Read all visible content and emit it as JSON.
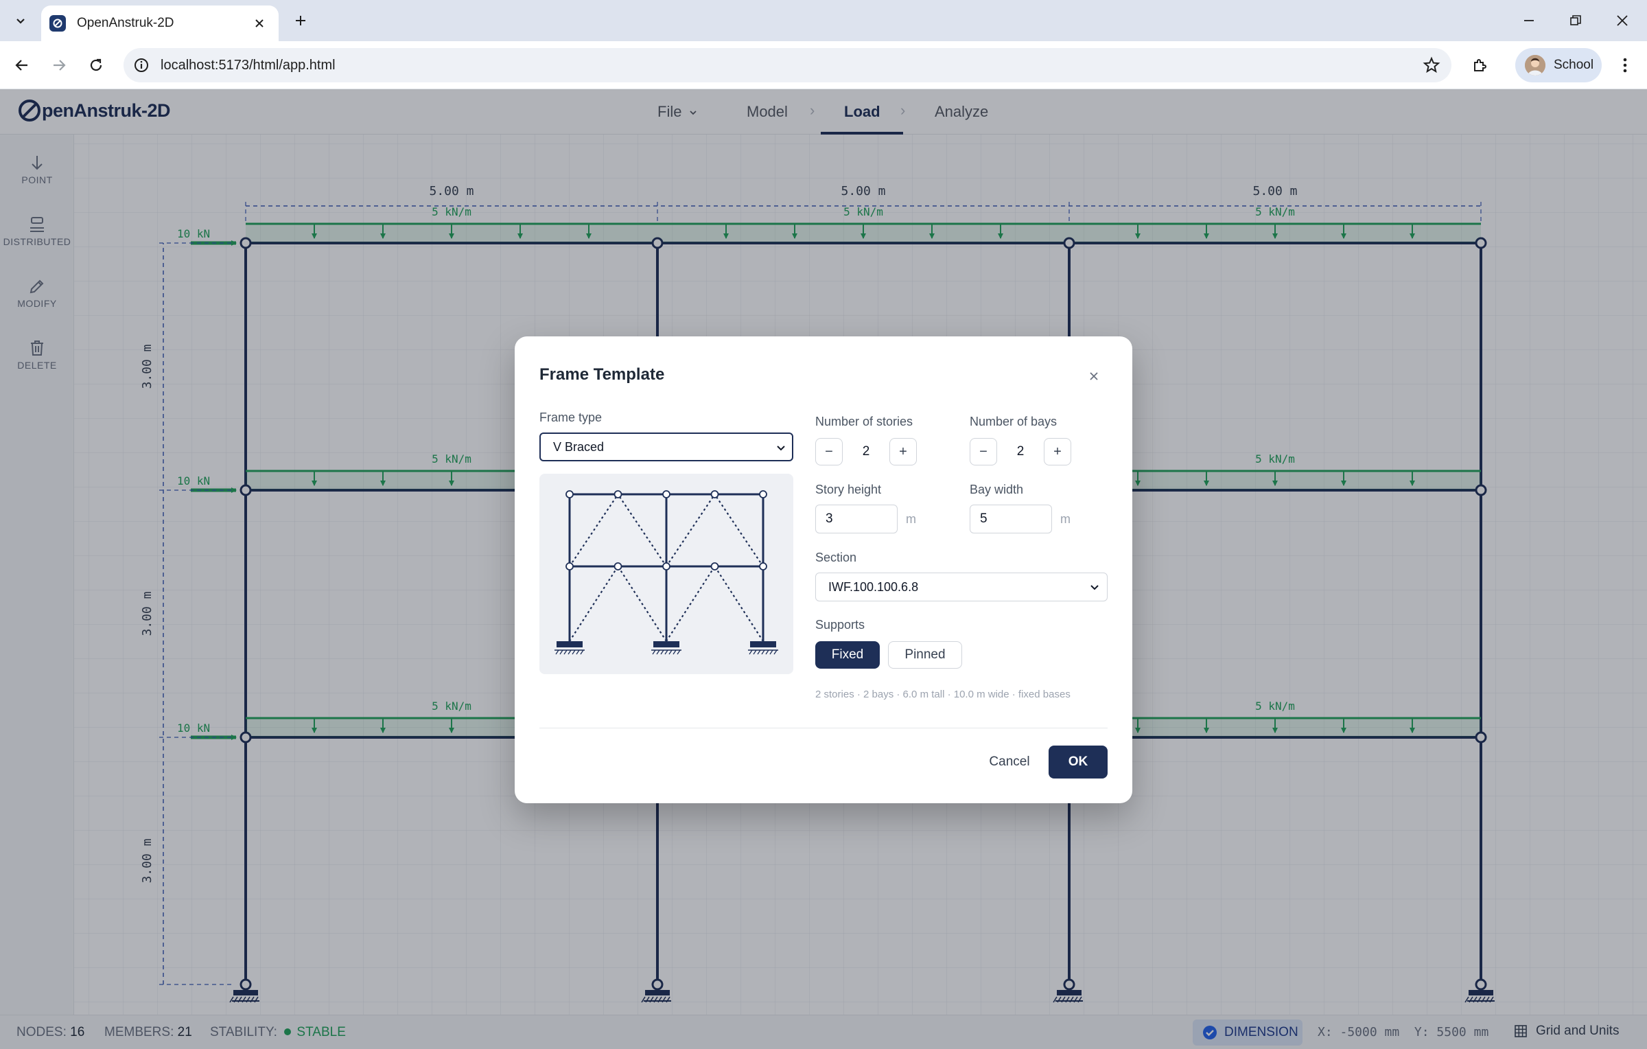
{
  "browser": {
    "tab_title": "OpenAnstruk-2D",
    "url": "localhost:5173/html/app.html",
    "profile_name": "School"
  },
  "app": {
    "logo_text": "penAnstruk-2D",
    "nav": {
      "file": "File",
      "model": "Model",
      "load": "Load",
      "analyze": "Analyze",
      "separator": "›",
      "active": "Load"
    },
    "tools": [
      {
        "label": "POINT",
        "icon": "arrow-down-icon"
      },
      {
        "label": "DISTRIBUTED",
        "icon": "distributed-load-icon"
      },
      {
        "label": "MODIFY",
        "icon": "pencil-icon"
      },
      {
        "label": "DELETE",
        "icon": "trash-icon"
      }
    ]
  },
  "drawing": {
    "bay_dims": [
      "5.00 m",
      "5.00 m",
      "5.00 m"
    ],
    "story_dims": [
      "3.00 m",
      "3.00 m",
      "3.00 m"
    ],
    "udl_label": "5 kN/m",
    "point_load_label": "10 kN",
    "colors": {
      "frame": "#1e2f57",
      "load": "#22a35a",
      "dimension": "#3b5bb5"
    }
  },
  "status": {
    "nodes_label": "NODES:",
    "nodes_value": "16",
    "members_label": "MEMBERS:",
    "members_value": "21",
    "stability_label": "STABILITY:",
    "stability_value": "STABLE",
    "dimension_label": "DIMENSION",
    "coord_x": "X: -5000 mm",
    "coord_y": "Y: 5500 mm",
    "grid_units_label": "Grid and Units"
  },
  "dialog": {
    "title": "Frame Template",
    "frame_type_label": "Frame type",
    "frame_type_value": "V Braced",
    "stories_label": "Number of stories",
    "stories_value": "2",
    "bays_label": "Number of bays",
    "bays_value": "2",
    "story_height_label": "Story height",
    "story_height_value": "3",
    "bay_width_label": "Bay width",
    "bay_width_value": "5",
    "unit": "m",
    "section_label": "Section",
    "section_value": "IWF.100.100.6.8",
    "supports_label": "Supports",
    "support_fixed": "Fixed",
    "support_pinned": "Pinned",
    "support_selected": "Fixed",
    "summary": "2 stories · 2 bays · 6.0 m tall · 10.0 m wide · fixed bases",
    "cancel": "Cancel",
    "ok": "OK",
    "minus": "−",
    "plus": "+"
  }
}
